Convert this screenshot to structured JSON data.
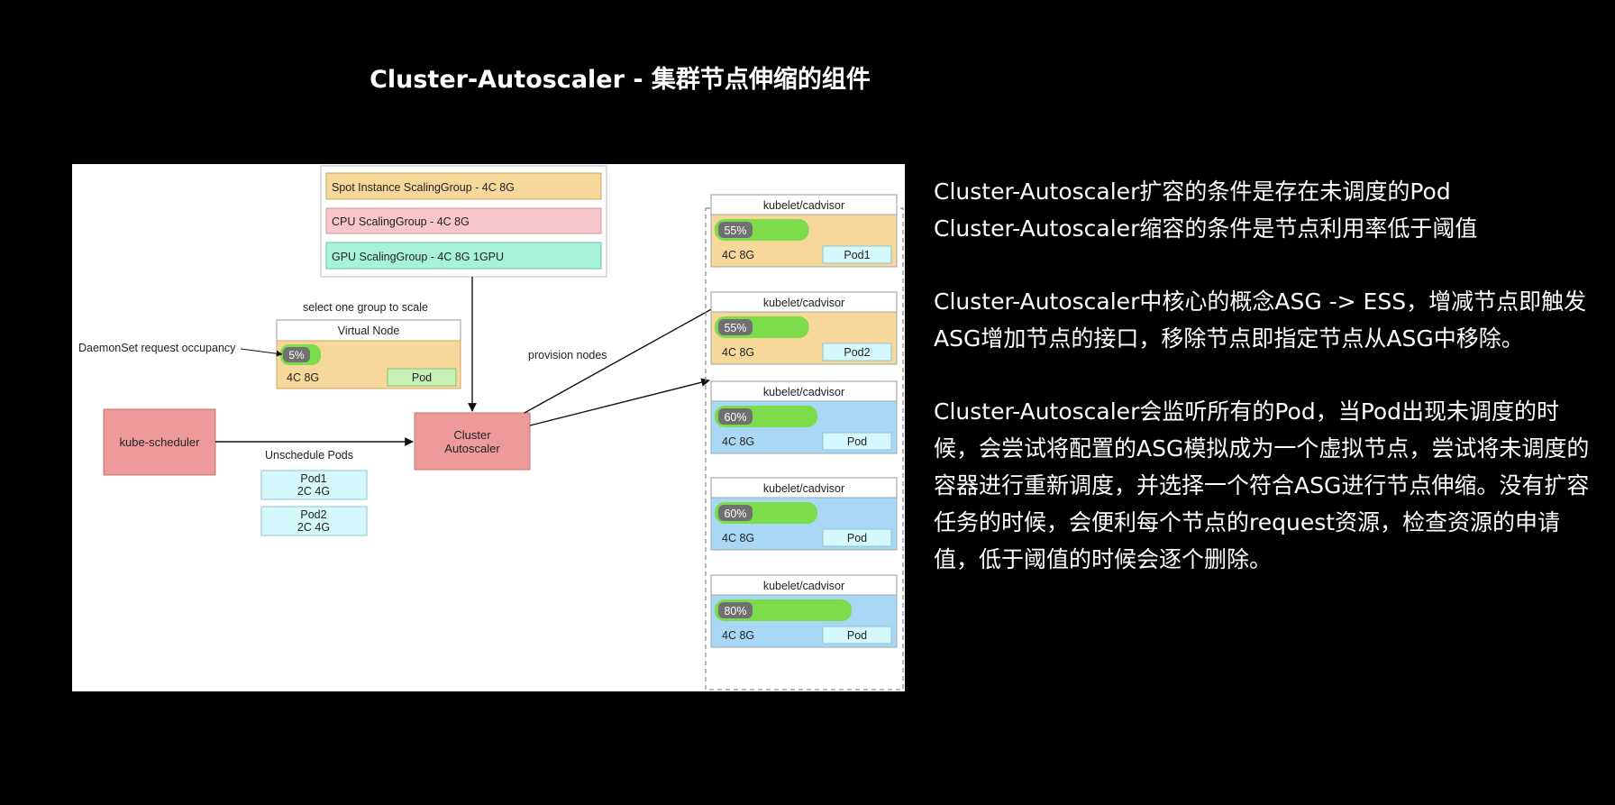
{
  "title": "Cluster-Autoscaler - 集群节点伸缩的组件",
  "diagram": {
    "scaling_groups": [
      {
        "label": "Spot Instance ScalingGroup - 4C 8G",
        "color": "#f7d79a"
      },
      {
        "label": "CPU ScalingGroup - 4C 8G",
        "color": "#f6c6c8"
      },
      {
        "label": "GPU ScalingGroup - 4C 8G 1GPU",
        "color": "#a6f2da"
      }
    ],
    "select_group_label": "select one group to scale",
    "virtual_node": {
      "header": "Virtual Node",
      "usage": "5%",
      "spec": "4C 8G",
      "pod": "Pod"
    },
    "daemonset_label": "DaemonSet request occupancy",
    "kube_scheduler": "kube-scheduler",
    "cluster_autoscaler": "Cluster Autoscaler",
    "unschedule_label": "Unschedule Pods",
    "pending_pods": [
      {
        "name": "Pod1",
        "spec": "2C 4G"
      },
      {
        "name": "Pod2",
        "spec": "2C 4G"
      }
    ],
    "provision_label": "provision nodes",
    "nodes": [
      {
        "header": "kubelet/cadvisor",
        "usage": "55%",
        "usage_fraction": 0.55,
        "spec": "4C 8G",
        "pod": "Pod1",
        "color": "#f7d79a"
      },
      {
        "header": "kubelet/cadvisor",
        "usage": "55%",
        "usage_fraction": 0.55,
        "spec": "4C 8G",
        "pod": "Pod2",
        "color": "#f7d79a"
      },
      {
        "header": "kubelet/cadvisor",
        "usage": "60%",
        "usage_fraction": 0.6,
        "spec": "4C 8G",
        "pod": "Pod",
        "color": "#a9d8f6"
      },
      {
        "header": "kubelet/cadvisor",
        "usage": "60%",
        "usage_fraction": 0.6,
        "spec": "4C 8G",
        "pod": "Pod",
        "color": "#a9d8f6"
      },
      {
        "header": "kubelet/cadvisor",
        "usage": "80%",
        "usage_fraction": 0.8,
        "spec": "4C 8G",
        "pod": "Pod",
        "color": "#a9d8f6"
      }
    ],
    "colors": {
      "scheduler": "#ee9a9a",
      "autoscaler": "#ee9a9a",
      "pending_pod": "#d4f8fb",
      "pod_box": "#d4f8fb",
      "virtual_pod": "#c7f0b4",
      "bar_green": "#7cdc4a",
      "badge": "#707070"
    }
  },
  "notes": [
    "Cluster-Autoscaler扩容的条件是存在未调度的Pod\nCluster-Autoscaler缩容的条件是节点利用率低于阈值",
    "Cluster-Autoscaler中核心的概念ASG -> ESS，增减节点即触发ASG增加节点的接口，移除节点即指定节点从ASG中移除。",
    "Cluster-Autoscaler会监听所有的Pod，当Pod出现未调度的时候，会尝试将配置的ASG模拟成为一个虚拟节点，尝试将未调度的容器进行重新调度，并选择一个符合ASG进行节点伸缩。没有扩容任务的时候，会便利每个节点的request资源，检查资源的申请值，低于阈值的时候会逐个删除。"
  ]
}
